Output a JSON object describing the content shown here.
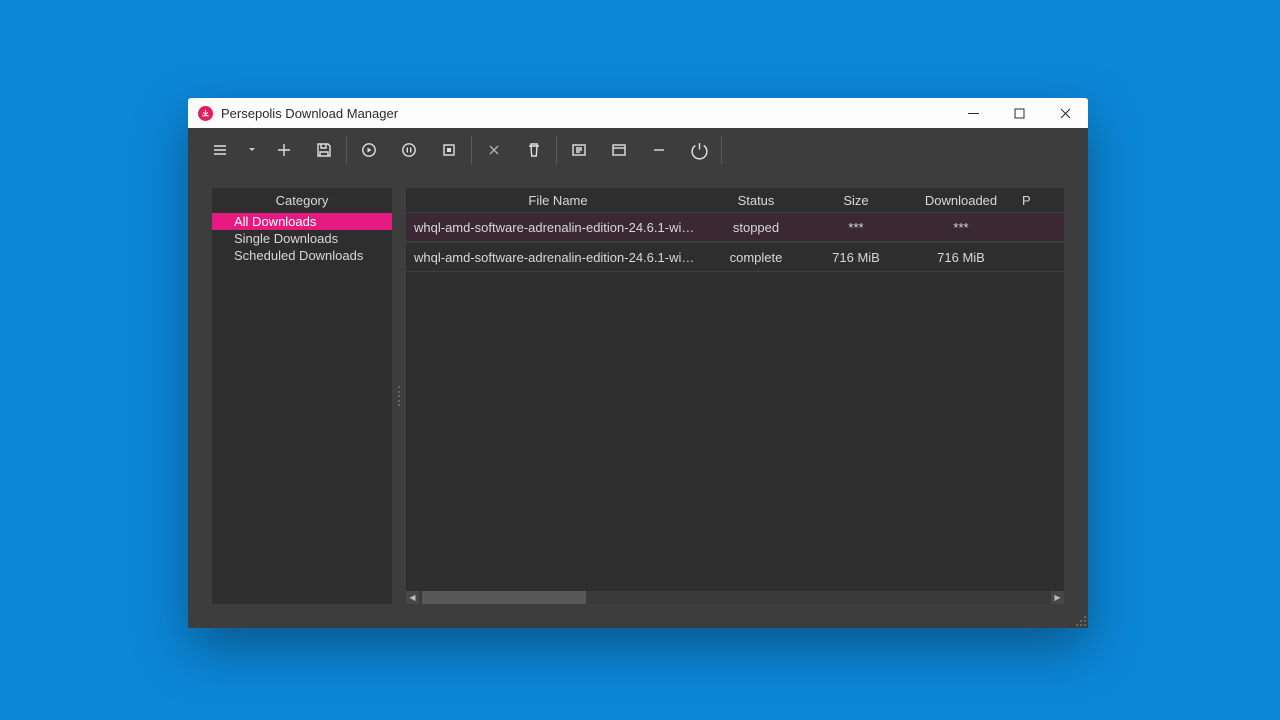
{
  "window": {
    "title": "Persepolis Download Manager"
  },
  "colors": {
    "accent": "#e51a80",
    "app_icon_bg": "#de1f59",
    "background": "#0c87d8"
  },
  "sidebar": {
    "header": "Category",
    "items": [
      {
        "label": "All Downloads",
        "selected": true
      },
      {
        "label": "Single Downloads",
        "selected": false
      },
      {
        "label": "Scheduled Downloads",
        "selected": false
      }
    ]
  },
  "table": {
    "columns": {
      "filename": "File Name",
      "status": "Status",
      "size": "Size",
      "downloaded": "Downloaded",
      "overflow": "P"
    },
    "rows": [
      {
        "filename": "whql-amd-software-adrenalin-edition-24.6.1-win10-...",
        "status": "stopped",
        "size": "***",
        "downloaded": "***",
        "selected": true
      },
      {
        "filename": "whql-amd-software-adrenalin-edition-24.6.1-win10-...",
        "status": "complete",
        "size": "716 MiB",
        "downloaded": "716 MiB",
        "selected": false
      }
    ]
  },
  "toolbar": {
    "icons": [
      "menu-icon",
      "dropdown-caret-icon",
      "add-icon",
      "save-icon",
      "play-icon",
      "pause-icon",
      "stop-icon",
      "close-small-icon",
      "trash-icon",
      "details-icon",
      "window-icon",
      "minimize-icon",
      "power-icon"
    ]
  }
}
